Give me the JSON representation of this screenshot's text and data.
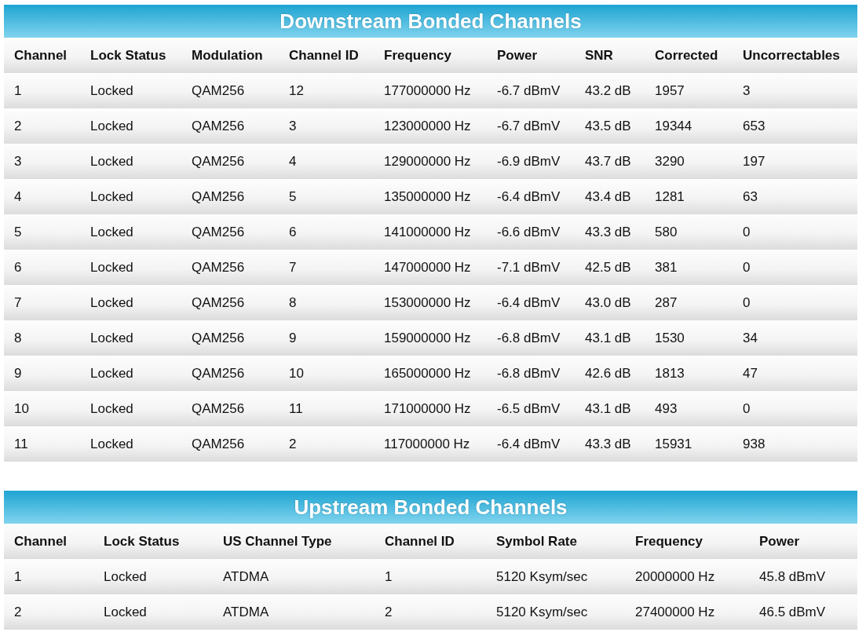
{
  "tables": [
    {
      "title": "Downstream Bonded Channels",
      "columns": [
        "Channel",
        "Lock Status",
        "Modulation",
        "Channel ID",
        "Frequency",
        "Power",
        "SNR",
        "Corrected",
        "Uncorrectables"
      ],
      "rows": [
        [
          "1",
          "Locked",
          "QAM256",
          "12",
          "177000000 Hz",
          "-6.7 dBmV",
          "43.2 dB",
          "1957",
          "3"
        ],
        [
          "2",
          "Locked",
          "QAM256",
          "3",
          "123000000 Hz",
          "-6.7 dBmV",
          "43.5 dB",
          "19344",
          "653"
        ],
        [
          "3",
          "Locked",
          "QAM256",
          "4",
          "129000000 Hz",
          "-6.9 dBmV",
          "43.7 dB",
          "3290",
          "197"
        ],
        [
          "4",
          "Locked",
          "QAM256",
          "5",
          "135000000 Hz",
          "-6.4 dBmV",
          "43.4 dB",
          "1281",
          "63"
        ],
        [
          "5",
          "Locked",
          "QAM256",
          "6",
          "141000000 Hz",
          "-6.6 dBmV",
          "43.3 dB",
          "580",
          "0"
        ],
        [
          "6",
          "Locked",
          "QAM256",
          "7",
          "147000000 Hz",
          "-7.1 dBmV",
          "42.5 dB",
          "381",
          "0"
        ],
        [
          "7",
          "Locked",
          "QAM256",
          "8",
          "153000000 Hz",
          "-6.4 dBmV",
          "43.0 dB",
          "287",
          "0"
        ],
        [
          "8",
          "Locked",
          "QAM256",
          "9",
          "159000000 Hz",
          "-6.8 dBmV",
          "43.1 dB",
          "1530",
          "34"
        ],
        [
          "9",
          "Locked",
          "QAM256",
          "10",
          "165000000 Hz",
          "-6.8 dBmV",
          "42.6 dB",
          "1813",
          "47"
        ],
        [
          "10",
          "Locked",
          "QAM256",
          "11",
          "171000000 Hz",
          "-6.5 dBmV",
          "43.1 dB",
          "493",
          "0"
        ],
        [
          "11",
          "Locked",
          "QAM256",
          "2",
          "117000000 Hz",
          "-6.4 dBmV",
          "43.3 dB",
          "15931",
          "938"
        ]
      ]
    },
    {
      "title": "Upstream Bonded Channels",
      "columns": [
        "Channel",
        "Lock Status",
        "US Channel Type",
        "Channel ID",
        "Symbol Rate",
        "Frequency",
        "Power"
      ],
      "rows": [
        [
          "1",
          "Locked",
          "ATDMA",
          "1",
          "5120 Ksym/sec",
          "20000000 Hz",
          "45.8 dBmV"
        ],
        [
          "2",
          "Locked",
          "ATDMA",
          "2",
          "5120 Ksym/sec",
          "27400000 Hz",
          "46.5 dBmV"
        ]
      ]
    }
  ]
}
